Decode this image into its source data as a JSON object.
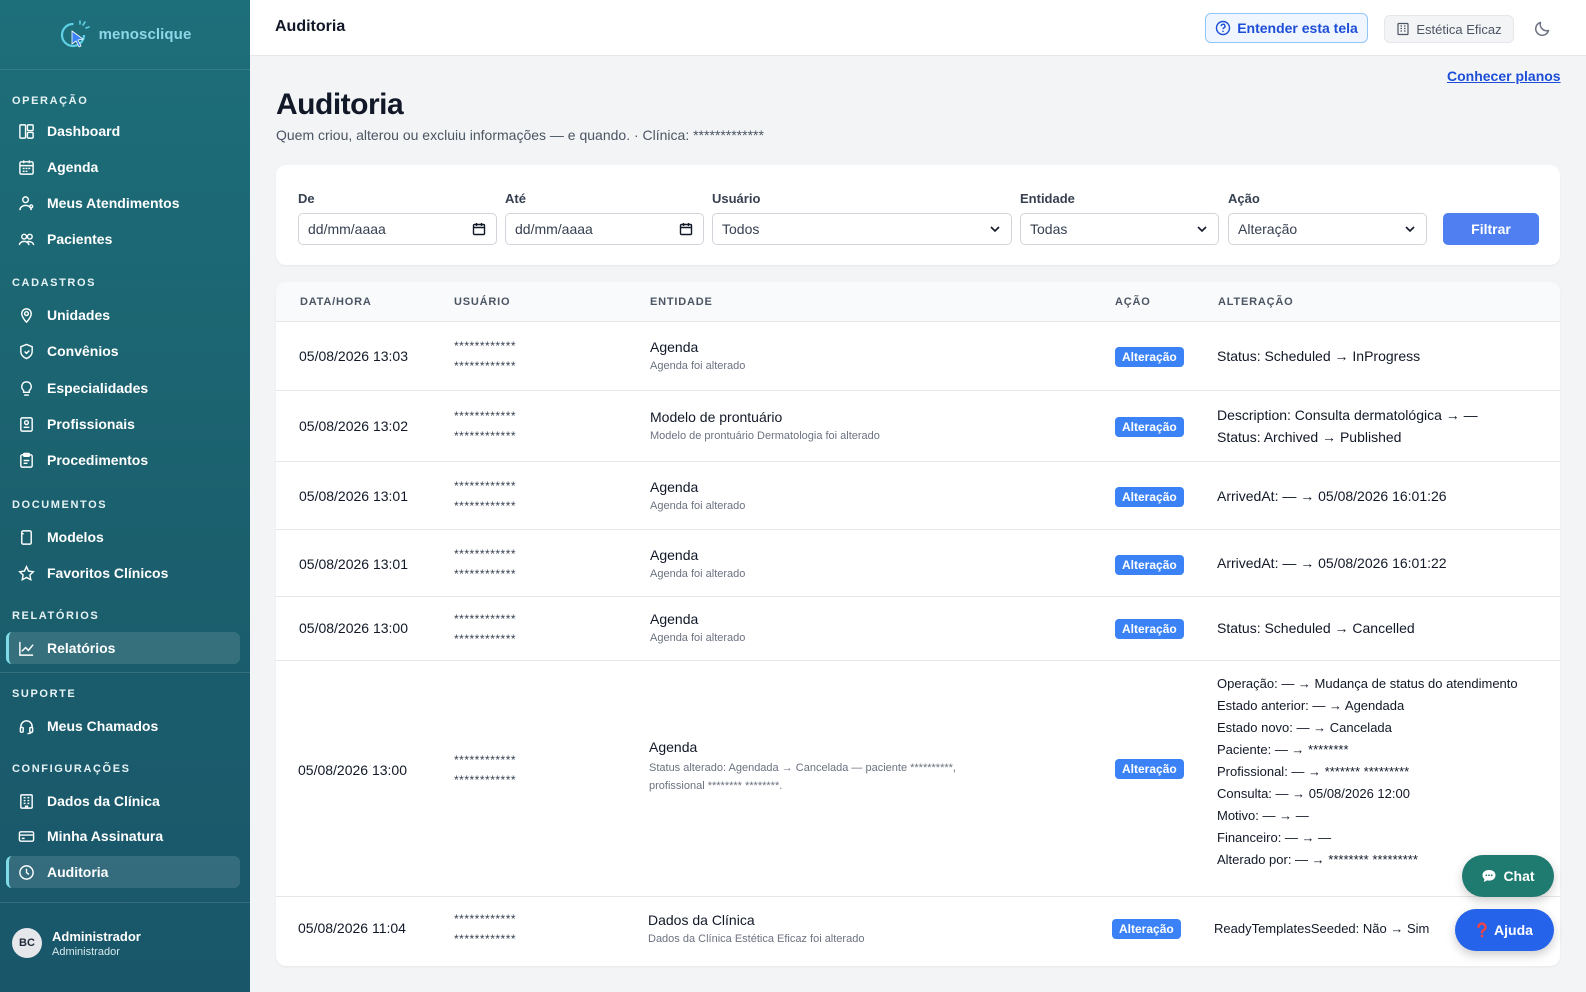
{
  "app": {
    "name": "menosclique"
  },
  "sidebar": {
    "sections": {
      "operacao": "OPERAÇÃO",
      "cadastros": "CADASTROS",
      "documentos": "DOCUMENTOS",
      "relatorios": "RELATÓRIOS",
      "suporte": "SUPORTE",
      "configuracoes": "CONFIGURAÇÕES"
    },
    "items": {
      "dashboard": "Dashboard",
      "agenda": "Agenda",
      "meus_atendimentos": "Meus Atendimentos",
      "pacientes": "Pacientes",
      "unidades": "Unidades",
      "convenios": "Convênios",
      "especialidades": "Especialidades",
      "profissionais": "Profissionais",
      "procedimentos": "Procedimentos",
      "modelos": "Modelos",
      "favoritos": "Favoritos Clínicos",
      "relatorios": "Relatórios",
      "meus_chamados": "Meus Chamados",
      "dados_clinica": "Dados da Clínica",
      "minha_assinatura": "Minha Assinatura",
      "auditoria": "Auditoria"
    },
    "user": {
      "initials": "BC",
      "name": "Administrador",
      "role": "Administrador"
    }
  },
  "header": {
    "title": "Auditoria",
    "understand_label": "Entender esta tela",
    "clinic_label": "Estética Eficaz"
  },
  "page": {
    "plans_link": "Conhecer planos",
    "title": "Auditoria",
    "subtitle": "Quem criou, alterou ou excluiu informações — e quando.  ·  Clínica: *************"
  },
  "filters": {
    "de_label": "De",
    "de_value": "dd/mm/aaaa",
    "ate_label": "Até",
    "ate_value": "dd/mm/aaaa",
    "usuario_label": "Usuário",
    "usuario_value": "Todos",
    "entidade_label": "Entidade",
    "entidade_value": "Todas",
    "acao_label": "Ação",
    "acao_value": "Alteração",
    "button": "Filtrar"
  },
  "table": {
    "headers": {
      "date": "DATA/HORA",
      "user": "USUÁRIO",
      "entity": "ENTIDADE",
      "action": "AÇÃO",
      "change": "ALTERAÇÃO"
    },
    "rows": [
      {
        "date": "05/08/2026 13:03",
        "user1": "************",
        "user2": "************",
        "entity": "Agenda",
        "entity_sub": "Agenda foi alterado",
        "action": "Alteração",
        "changes": [
          "Status: Scheduled → InProgress"
        ]
      },
      {
        "date": "05/08/2026 13:02",
        "user1": "************",
        "user2": "************",
        "entity": "Modelo de prontuário",
        "entity_sub": "Modelo de prontuário Dermatologia foi alterado",
        "action": "Alteração",
        "changes": [
          "Description: Consulta dermatológica → —",
          "Status: Archived → Published"
        ]
      },
      {
        "date": "05/08/2026 13:01",
        "user1": "************",
        "user2": "************",
        "entity": "Agenda",
        "entity_sub": "Agenda foi alterado",
        "action": "Alteração",
        "changes": [
          "ArrivedAt: — → 05/08/2026 16:01:26"
        ]
      },
      {
        "date": "05/08/2026 13:01",
        "user1": "************",
        "user2": "************",
        "entity": "Agenda",
        "entity_sub": "Agenda foi alterado",
        "action": "Alteração",
        "changes": [
          "ArrivedAt: — → 05/08/2026 16:01:22"
        ]
      },
      {
        "date": "05/08/2026 13:00",
        "user1": "************",
        "user2": "************",
        "entity": "Agenda",
        "entity_sub": "Agenda foi alterado",
        "action": "Alteração",
        "changes": [
          "Status: Scheduled → Cancelled"
        ]
      },
      {
        "date": "05/08/2026 13:00",
        "user1": "************",
        "user2": "************",
        "entity": "Agenda",
        "entity_sub": "Status alterado: Agendada → Cancelada — paciente **********, profissional ******** ********.",
        "action": "Alteração",
        "changes": [
          "Operação: — → Mudança de status do atendimento",
          "Estado anterior: — → Agendada",
          "Estado novo: — → Cancelada",
          "Paciente: — → ********",
          "Profissional: — → ******* *********",
          "Consulta: — → 05/08/2026 12:00",
          "Motivo: — → —",
          "Financeiro: — → —",
          "Alterado por: — → ******** *********"
        ]
      },
      {
        "date": "05/08/2026 11:04",
        "user1": "************",
        "user2": "************",
        "entity": "Dados da Clínica",
        "entity_sub": "Dados da Clínica Estética Eficaz foi alterado",
        "action": "Alteração",
        "changes": [
          "ReadyTemplatesSeeded: Não → Sim"
        ]
      }
    ]
  },
  "fabs": {
    "chat": "Chat",
    "help": "Ajuda"
  }
}
